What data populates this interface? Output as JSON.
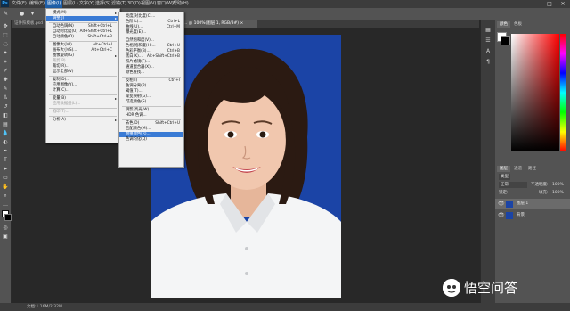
{
  "menubar": {
    "logo": "Ps",
    "items": [
      "文件(F)",
      "编辑(E)",
      "图像(I)",
      "图层(L)",
      "文字(Y)",
      "选择(S)",
      "滤镜(T)",
      "3D(D)",
      "视图(V)",
      "窗口(W)",
      "帮助(H)"
    ],
    "active_index": 2
  },
  "window_controls": {
    "minimize": "—",
    "maximize": "□",
    "close": "✕"
  },
  "tabs": [
    {
      "label": "证件照模板.psd"
    },
    {
      "label": "... @ 100%(图层 1, RGB/8#) ×"
    }
  ],
  "image_menu": {
    "items": [
      {
        "label": "模式(M)",
        "shortcut": "",
        "submenu": true,
        "disabled": false
      },
      {
        "label": "调整(J)",
        "shortcut": "",
        "submenu": true,
        "disabled": false,
        "highlight": true
      },
      {
        "sep": true
      },
      {
        "label": "自动色调(N)",
        "shortcut": "Shift+Ctrl+L",
        "disabled": false
      },
      {
        "label": "自动对比度(U)",
        "shortcut": "Alt+Shift+Ctrl+L",
        "disabled": false
      },
      {
        "label": "自动颜色(O)",
        "shortcut": "Shift+Ctrl+B",
        "disabled": false
      },
      {
        "sep": true
      },
      {
        "label": "图像大小(I)...",
        "shortcut": "Alt+Ctrl+I",
        "disabled": false
      },
      {
        "label": "画布大小(S)...",
        "shortcut": "Alt+Ctrl+C",
        "disabled": false
      },
      {
        "label": "图像旋转(G)",
        "shortcut": "",
        "submenu": true,
        "disabled": false
      },
      {
        "label": "裁剪(P)",
        "shortcut": "",
        "disabled": true
      },
      {
        "label": "裁切(R)...",
        "shortcut": "",
        "disabled": false
      },
      {
        "label": "显示全部(V)",
        "shortcut": "",
        "disabled": false
      },
      {
        "sep": true
      },
      {
        "label": "复制(D)...",
        "shortcut": "",
        "disabled": false
      },
      {
        "label": "应用图像(Y)...",
        "shortcut": "",
        "disabled": false
      },
      {
        "label": "计算(C)...",
        "shortcut": "",
        "disabled": false
      },
      {
        "sep": true
      },
      {
        "label": "变量(B)",
        "shortcut": "",
        "submenu": true,
        "disabled": false
      },
      {
        "label": "应用数据组(L)...",
        "shortcut": "",
        "disabled": true
      },
      {
        "sep": true
      },
      {
        "label": "陷印(T)...",
        "shortcut": "",
        "disabled": true
      },
      {
        "sep": true
      },
      {
        "label": "分析(A)",
        "shortcut": "",
        "submenu": true,
        "disabled": false
      }
    ]
  },
  "adjust_menu": {
    "items": [
      {
        "label": "亮度/对比度(C)...",
        "shortcut": ""
      },
      {
        "label": "色阶(L)...",
        "shortcut": "Ctrl+L"
      },
      {
        "label": "曲线(U)...",
        "shortcut": "Ctrl+M"
      },
      {
        "label": "曝光度(E)...",
        "shortcut": ""
      },
      {
        "sep": true
      },
      {
        "label": "自然饱和度(V)...",
        "shortcut": ""
      },
      {
        "label": "色相/饱和度(H)...",
        "shortcut": "Ctrl+U"
      },
      {
        "label": "色彩平衡(B)...",
        "shortcut": "Ctrl+B"
      },
      {
        "label": "黑白(K)...",
        "shortcut": "Alt+Shift+Ctrl+B"
      },
      {
        "label": "照片滤镜(F)...",
        "shortcut": ""
      },
      {
        "label": "通道混合器(X)...",
        "shortcut": ""
      },
      {
        "label": "颜色查找...",
        "shortcut": ""
      },
      {
        "sep": true
      },
      {
        "label": "反相(I)",
        "shortcut": "Ctrl+I"
      },
      {
        "label": "色调分离(P)...",
        "shortcut": ""
      },
      {
        "label": "阈值(T)...",
        "shortcut": ""
      },
      {
        "label": "渐变映射(G)...",
        "shortcut": ""
      },
      {
        "label": "可选颜色(S)...",
        "shortcut": ""
      },
      {
        "sep": true
      },
      {
        "label": "阴影/高光(W)...",
        "shortcut": ""
      },
      {
        "label": "HDR 色调...",
        "shortcut": ""
      },
      {
        "sep": true
      },
      {
        "label": "去色(D)",
        "shortcut": "Shift+Ctrl+U"
      },
      {
        "label": "匹配颜色(M)...",
        "shortcut": ""
      },
      {
        "label": "替换颜色(R)...",
        "shortcut": "",
        "highlight": true
      },
      {
        "label": "色调均化(Q)",
        "shortcut": ""
      }
    ]
  },
  "panels": {
    "color_tabs": [
      "颜色",
      "色板"
    ],
    "layer_tabs": [
      "图层",
      "通道",
      "路径"
    ],
    "layer_kind": "类型",
    "blend_mode": "正常",
    "opacity_label": "不透明度:",
    "opacity_value": "100%",
    "lock_label": "锁定:",
    "fill_label": "填充:",
    "fill_value": "100%",
    "layers": [
      {
        "name": "图层 1",
        "selected": true
      },
      {
        "name": "背景",
        "selected": false
      }
    ]
  },
  "status": {
    "text": "文档:1.16M/2.32M"
  },
  "watermark": {
    "text": "悟空问答"
  },
  "colors": {
    "canvas_bg": "#1b44a6",
    "menu_highlight": "#3a7bd5",
    "menubar_active": "#1f5fa8"
  }
}
